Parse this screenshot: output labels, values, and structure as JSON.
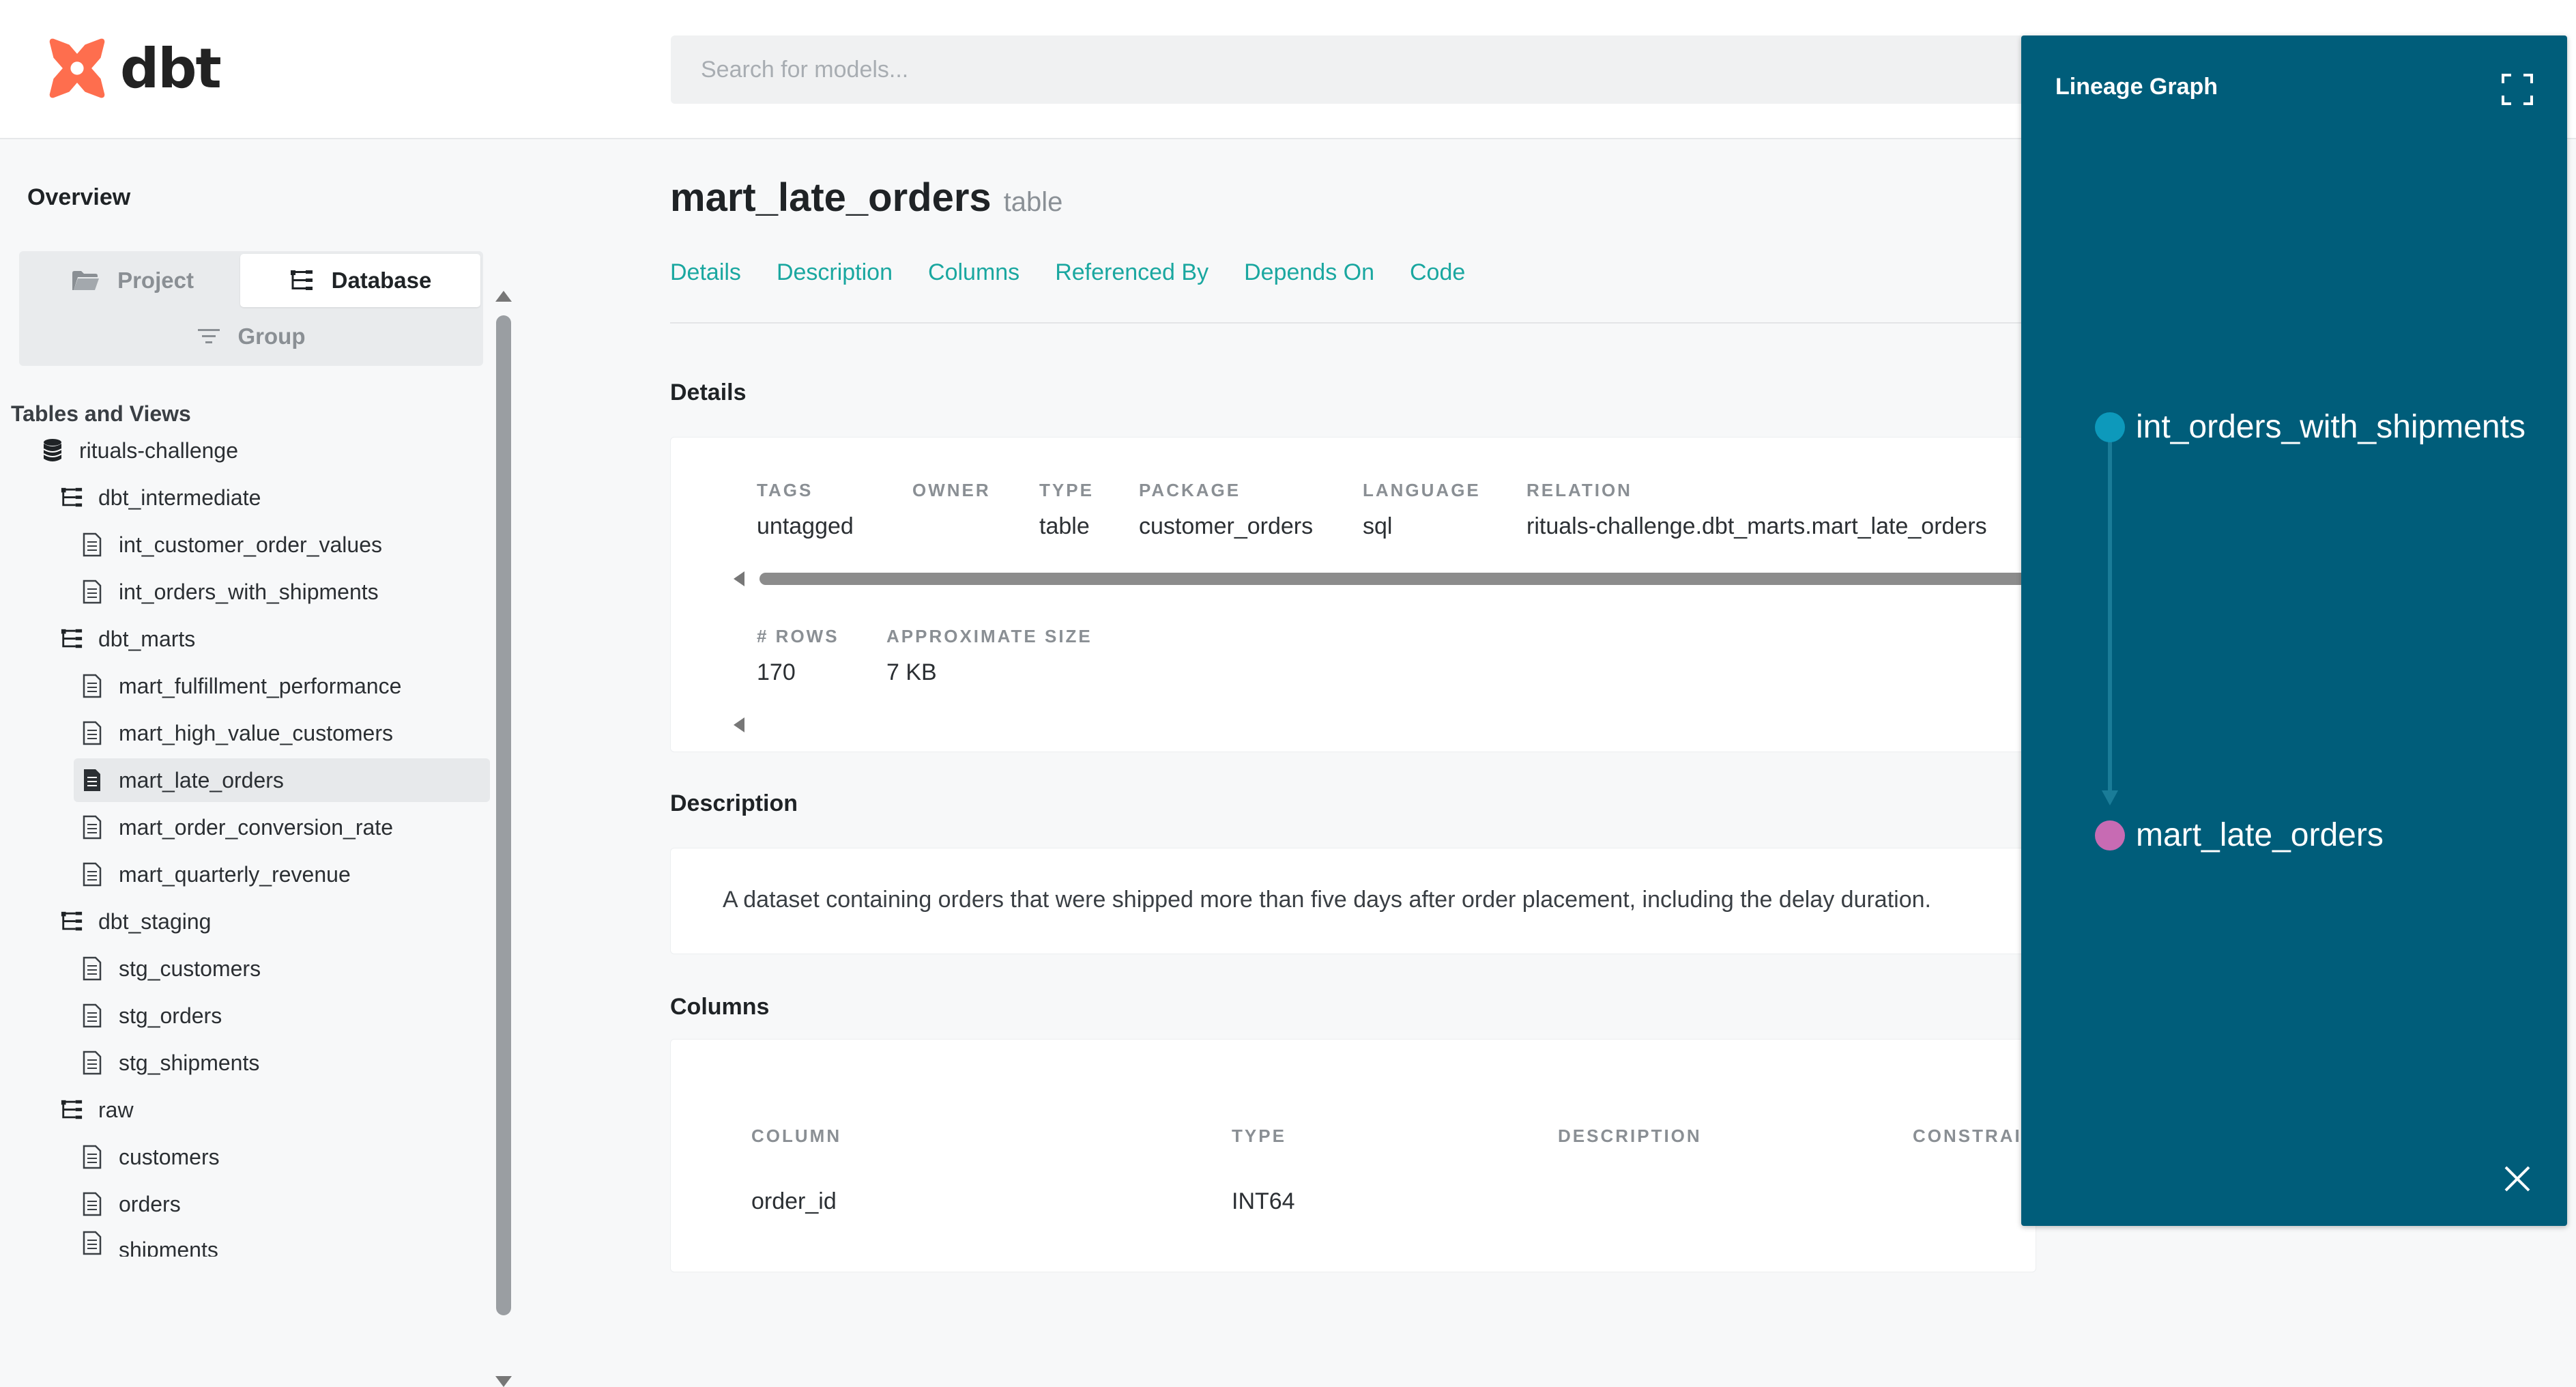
{
  "header": {
    "logo_text": "dbt",
    "search_placeholder": "Search for models..."
  },
  "sidebar": {
    "overview_label": "Overview",
    "tabs": {
      "project": "Project",
      "database": "Database",
      "group": "Group"
    },
    "tables_views_title": "Tables and Views",
    "tree": [
      {
        "label": "rituals-challenge",
        "type": "database",
        "level": 0
      },
      {
        "label": "dbt_intermediate",
        "type": "schema",
        "level": 1
      },
      {
        "label": "int_customer_order_values",
        "type": "model",
        "level": 2
      },
      {
        "label": "int_orders_with_shipments",
        "type": "model",
        "level": 2
      },
      {
        "label": "dbt_marts",
        "type": "schema",
        "level": 1
      },
      {
        "label": "mart_fulfillment_performance",
        "type": "model",
        "level": 2
      },
      {
        "label": "mart_high_value_customers",
        "type": "model",
        "level": 2
      },
      {
        "label": "mart_late_orders",
        "type": "model",
        "level": 2,
        "active": true
      },
      {
        "label": "mart_order_conversion_rate",
        "type": "model",
        "level": 2
      },
      {
        "label": "mart_quarterly_revenue",
        "type": "model",
        "level": 2
      },
      {
        "label": "dbt_staging",
        "type": "schema",
        "level": 1
      },
      {
        "label": "stg_customers",
        "type": "model",
        "level": 2
      },
      {
        "label": "stg_orders",
        "type": "model",
        "level": 2
      },
      {
        "label": "stg_shipments",
        "type": "model",
        "level": 2
      },
      {
        "label": "raw",
        "type": "schema",
        "level": 1
      },
      {
        "label": "customers",
        "type": "model",
        "level": 2
      },
      {
        "label": "orders",
        "type": "model",
        "level": 2
      },
      {
        "label": "shipments",
        "type": "model",
        "level": 2
      }
    ]
  },
  "model": {
    "name": "mart_late_orders",
    "kind": "table",
    "tabs": [
      "Details",
      "Description",
      "Columns",
      "Referenced By",
      "Depends On",
      "Code"
    ]
  },
  "details": {
    "title": "Details",
    "fields": [
      {
        "key": "TAGS",
        "value": "untagged"
      },
      {
        "key": "OWNER",
        "value": ""
      },
      {
        "key": "TYPE",
        "value": "table"
      },
      {
        "key": "PACKAGE",
        "value": "customer_orders"
      },
      {
        "key": "LANGUAGE",
        "value": "sql"
      },
      {
        "key": "RELATION",
        "value": "rituals-challenge.dbt_marts.mart_late_orders"
      }
    ],
    "stats": [
      {
        "key": "# ROWS",
        "value": "170"
      },
      {
        "key": "APPROXIMATE SIZE",
        "value": "7 KB"
      }
    ]
  },
  "description": {
    "title": "Description",
    "text": "A dataset containing orders that were shipped more than five days after order placement, including the delay duration."
  },
  "columns": {
    "title": "Columns",
    "headers": [
      "COLUMN",
      "TYPE",
      "DESCRIPTION",
      "CONSTRAI"
    ],
    "rows": [
      {
        "column": "order_id",
        "type": "INT64",
        "description": ""
      }
    ]
  },
  "lineage": {
    "title": "Lineage Graph",
    "nodes": [
      {
        "label": "int_orders_with_shipments",
        "color": "#0d99bb"
      },
      {
        "label": "mart_late_orders",
        "color": "#c76bb3"
      }
    ],
    "panel_color": "#005d7a"
  },
  "colors": {
    "brand_orange": "#fe6e4e",
    "link_teal": "#1aa7a0"
  }
}
